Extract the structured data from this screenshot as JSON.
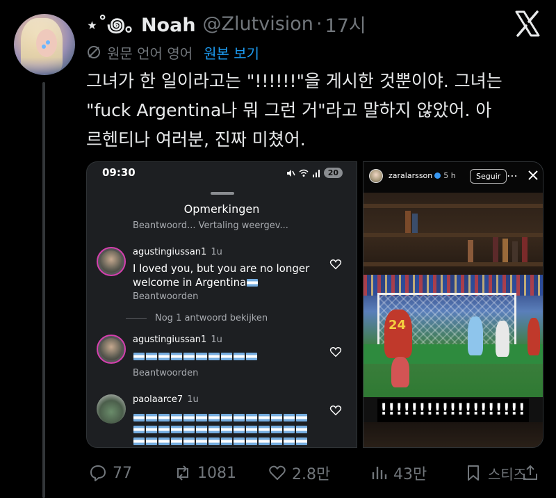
{
  "tweet": {
    "display_name": "⋆˚꩜｡ Noah",
    "handle": "@Zlutvision",
    "separator": "·",
    "time": "17시",
    "translation_label": "원문 언어 영어",
    "show_original": "원본 보기",
    "text": "그녀가 한 일이라고는 \"!!!!!!\"을 게시한 것뿐이야. 그녀는\n\"fuck Argentina나 뭐 그런 거\"라고 말하지 않았어. 아\n르헨티나 여러분, 진짜 미쳤어."
  },
  "left_image": {
    "clock": "09:30",
    "battery": "20",
    "sheet_title": "Opmerkingen",
    "cut_text": "Beantwoord...     Vertaling weergev...",
    "comments": [
      {
        "username": "agustingiussan1",
        "age": "1u",
        "text": "I loved you, but you are no longer welcome in Argentina",
        "reply": "Beantwoorden"
      },
      {
        "username": "agustingiussan1",
        "age": "1u",
        "reply": "Beantwoorden"
      },
      {
        "username": "paolaarce7",
        "age": "1u"
      }
    ],
    "view_more": "Nog 1 antwoord bekijken"
  },
  "right_image": {
    "username": "zaralarsson",
    "age": "5 h",
    "follow": "Seguir",
    "overlay_text": "!!!!!!!!!!!!!!!!!!!",
    "jersey_number": "24"
  },
  "actions": {
    "replies": "77",
    "retweets": "1081",
    "likes": "2.8만",
    "views": "43만",
    "bookmark_label": "스티즈"
  },
  "colors": {
    "background": "#000000",
    "text": "#e7e9ea",
    "muted": "#71767b",
    "link": "#1d9bf0"
  }
}
